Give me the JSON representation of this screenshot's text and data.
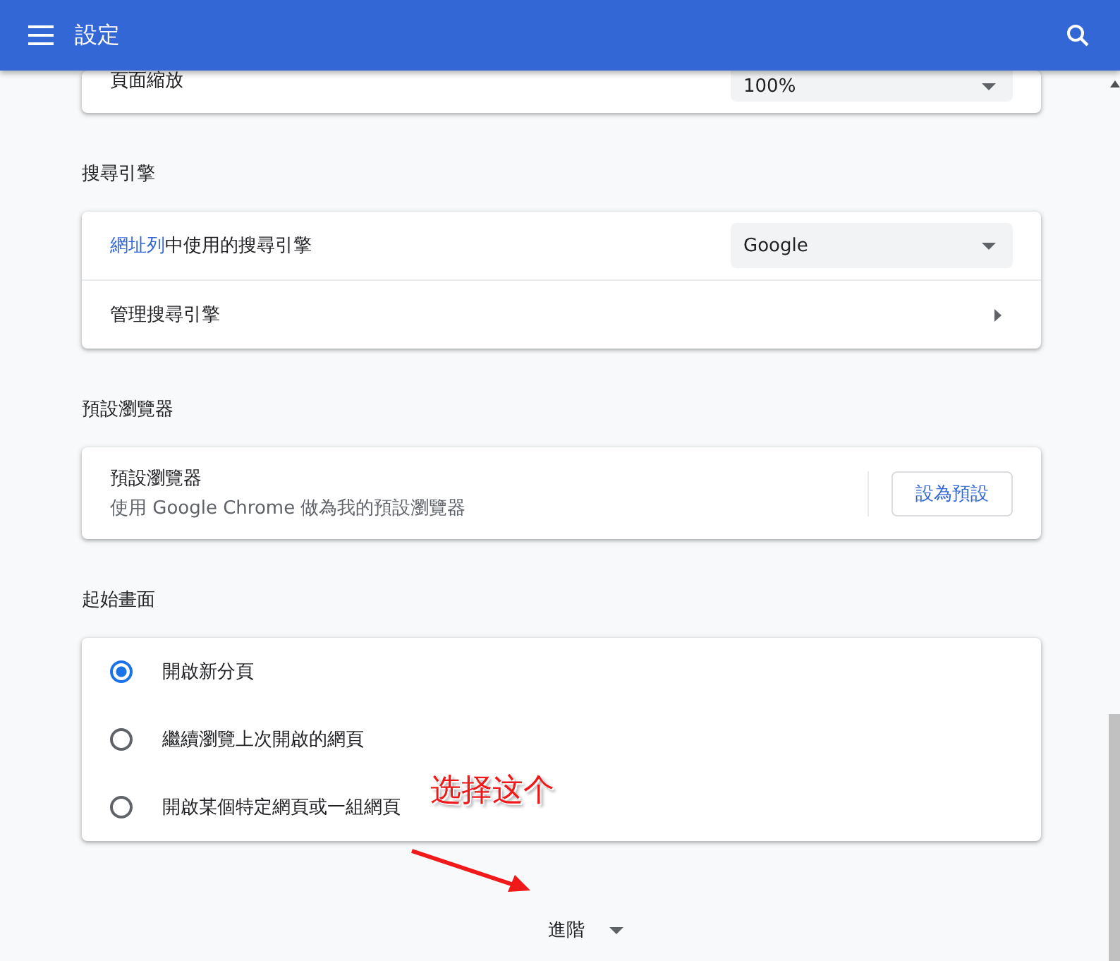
{
  "app_bar": {
    "title": "設定"
  },
  "zoom_row": {
    "label": "頁面縮放",
    "value": "100%"
  },
  "search_engine": {
    "heading": "搜尋引擎",
    "rows": [
      {
        "kind": "dropdown",
        "link": "網址列",
        "label": "中使用的搜尋引擎",
        "value": "Google"
      },
      {
        "kind": "submenu",
        "label": "管理搜尋引擎"
      }
    ]
  },
  "default_browser": {
    "heading": "預設瀏覽器",
    "title": "預設瀏覽器",
    "description": "使用 Google Chrome 做為我的預設瀏覽器",
    "button": "設為預設"
  },
  "on_startup": {
    "heading": "起始畫面",
    "options": [
      {
        "label": "開啟新分頁",
        "selected": true
      },
      {
        "label": "繼續瀏覽上次開啟的網頁",
        "selected": false
      },
      {
        "label": "開啟某個特定網頁或一組網頁",
        "selected": false
      }
    ]
  },
  "advanced": {
    "label": "進階"
  },
  "annotation": {
    "text": "选择这个"
  }
}
